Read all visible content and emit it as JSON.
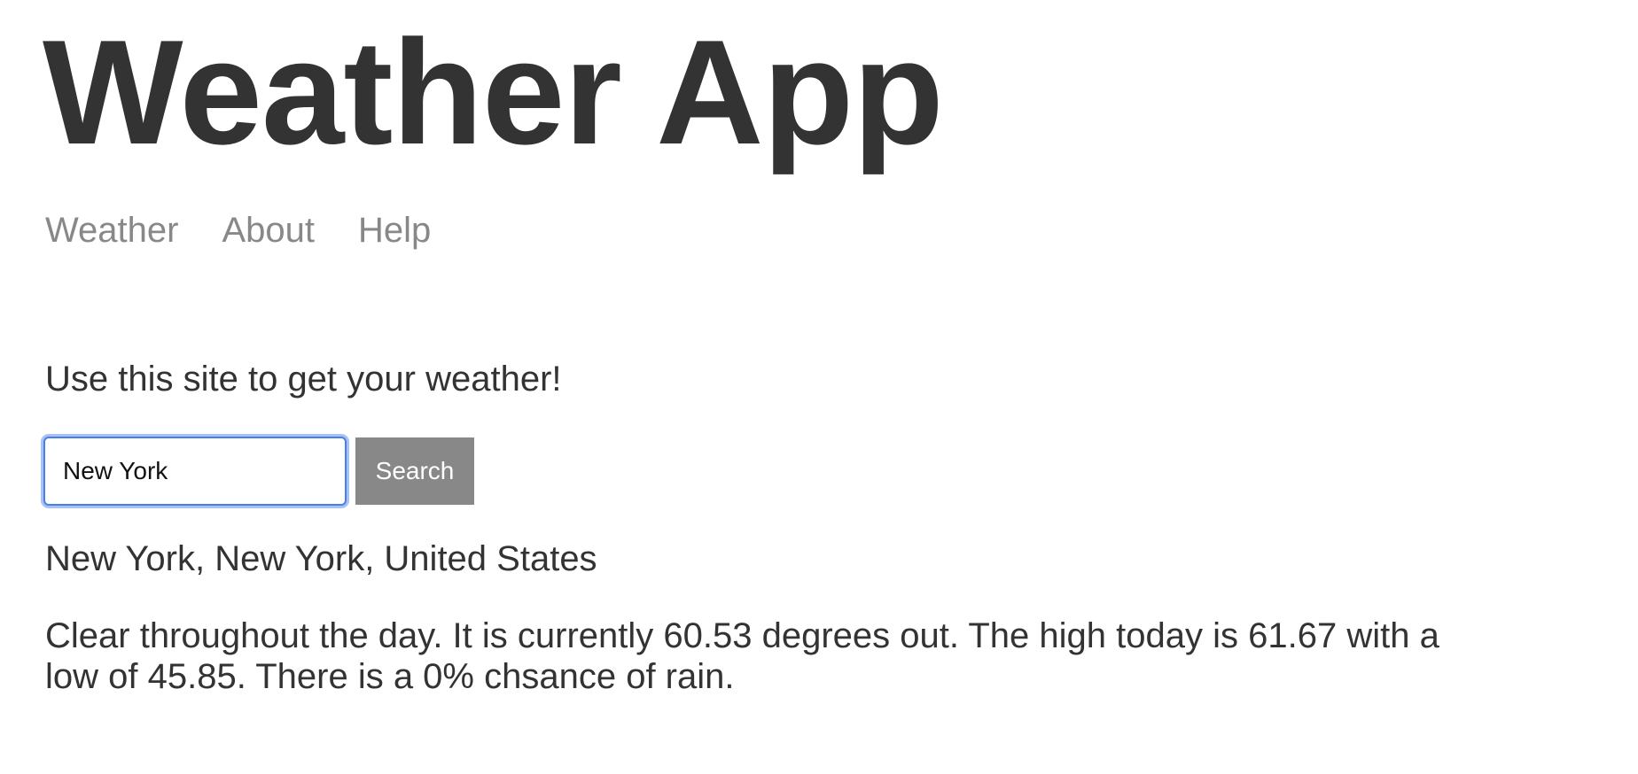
{
  "header": {
    "title": "Weather App"
  },
  "nav": {
    "items": [
      {
        "label": "Weather"
      },
      {
        "label": "About"
      },
      {
        "label": "Help"
      }
    ]
  },
  "main": {
    "intro": "Use this site to get your weather!",
    "search": {
      "value": "New York",
      "button_label": "Search"
    },
    "result": {
      "location": "New York, New York, United States",
      "forecast": "Clear throughout the day. It is currently 60.53 degrees out. The high today is 61.67 with a low of 45.85. There is a 0% chsance of rain."
    }
  },
  "colors": {
    "text": "#333333",
    "nav_link": "#888888",
    "button_bg": "#888888",
    "focus_ring": "#4a7fe8"
  }
}
